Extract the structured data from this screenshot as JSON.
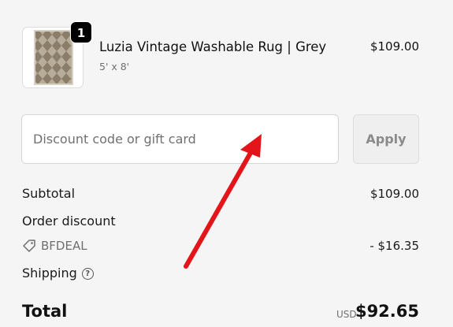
{
  "product": {
    "quantity": "1",
    "name": "Luzia Vintage Washable Rug | Grey",
    "variant": "5' x 8'",
    "price": "$109.00"
  },
  "discount": {
    "placeholder": "Discount code or gift card",
    "apply_label": "Apply"
  },
  "summary": {
    "subtotal_label": "Subtotal",
    "subtotal_value": "$109.00",
    "order_discount_label": "Order discount",
    "discount_code": "BFDEAL",
    "discount_value": "- $16.35",
    "shipping_label": "Shipping",
    "total_label": "Total",
    "total_currency": "USD",
    "total_value": "$92.65"
  },
  "colors": {
    "annotation_arrow": "#e3151a",
    "background": "#f5f5f5"
  }
}
